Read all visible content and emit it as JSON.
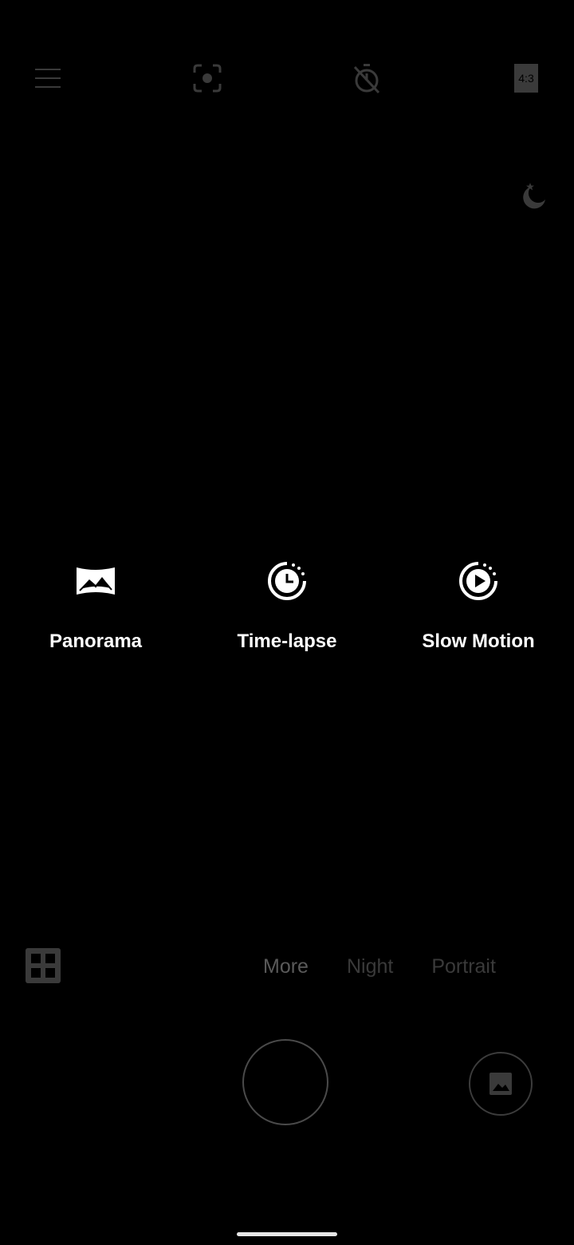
{
  "top_bar": {
    "menu_icon": "hamburger-menu-icon",
    "focus_icon": "focus-target-icon",
    "timer_icon": "timer-off-icon",
    "ratio_label": "4:3"
  },
  "night_indicator": {
    "icon": "moon-star-icon"
  },
  "more_modes": [
    {
      "label": "Panorama",
      "icon": "panorama-icon"
    },
    {
      "label": "Time-lapse",
      "icon": "time-lapse-icon"
    },
    {
      "label": "Slow Motion",
      "icon": "slow-motion-icon"
    }
  ],
  "mode_tabs": [
    {
      "label": "More",
      "active": true
    },
    {
      "label": "Night",
      "active": false
    },
    {
      "label": "Portrait",
      "active": false
    }
  ],
  "bottom": {
    "grid_icon": "grid-apps-icon",
    "shutter": "shutter-button",
    "gallery_icon": "gallery-image-icon"
  },
  "colors": {
    "background": "#000000",
    "dim_icon": "#3a3a3a",
    "label": "#ffffff",
    "active_tab": "#5a5a5a",
    "inactive_tab": "#3a3a3a"
  }
}
